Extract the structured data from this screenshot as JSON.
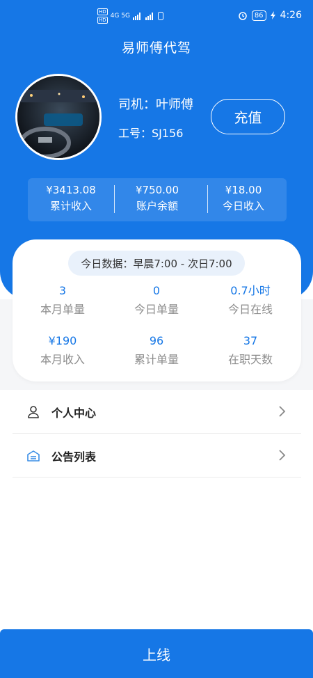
{
  "status_bar": {
    "left_tags": [
      "HD",
      "HD"
    ],
    "network": "4G 5G",
    "battery": "86",
    "time": "4:26"
  },
  "app": {
    "title": "易师傅代驾"
  },
  "driver": {
    "name_label": "司机：叶师傅",
    "id_label": "工号：SJ156",
    "recharge_label": "充值"
  },
  "summary": [
    {
      "value": "¥3413.08",
      "label": "累计收入"
    },
    {
      "value": "¥750.00",
      "label": "账户余额"
    },
    {
      "value": "¥18.00",
      "label": "今日收入"
    }
  ],
  "today_card": {
    "pill": "今日数据：早晨7:00 - 次日7:00",
    "metrics": [
      {
        "value": "3",
        "label": "本月单量"
      },
      {
        "value": "0",
        "label": "今日单量"
      },
      {
        "value": "0.7小时",
        "label": "今日在线"
      },
      {
        "value": "¥190",
        "label": "本月收入"
      },
      {
        "value": "96",
        "label": "累计单量"
      },
      {
        "value": "37",
        "label": "在职天数"
      }
    ]
  },
  "menu": [
    {
      "label": "个人中心",
      "icon": "person-icon"
    },
    {
      "label": "公告列表",
      "icon": "notice-icon"
    }
  ],
  "colors": {
    "primary": "#1677e6",
    "metric_value": "#1677e6",
    "muted": "#8c8c8c"
  },
  "online_button": {
    "label": "上线"
  }
}
